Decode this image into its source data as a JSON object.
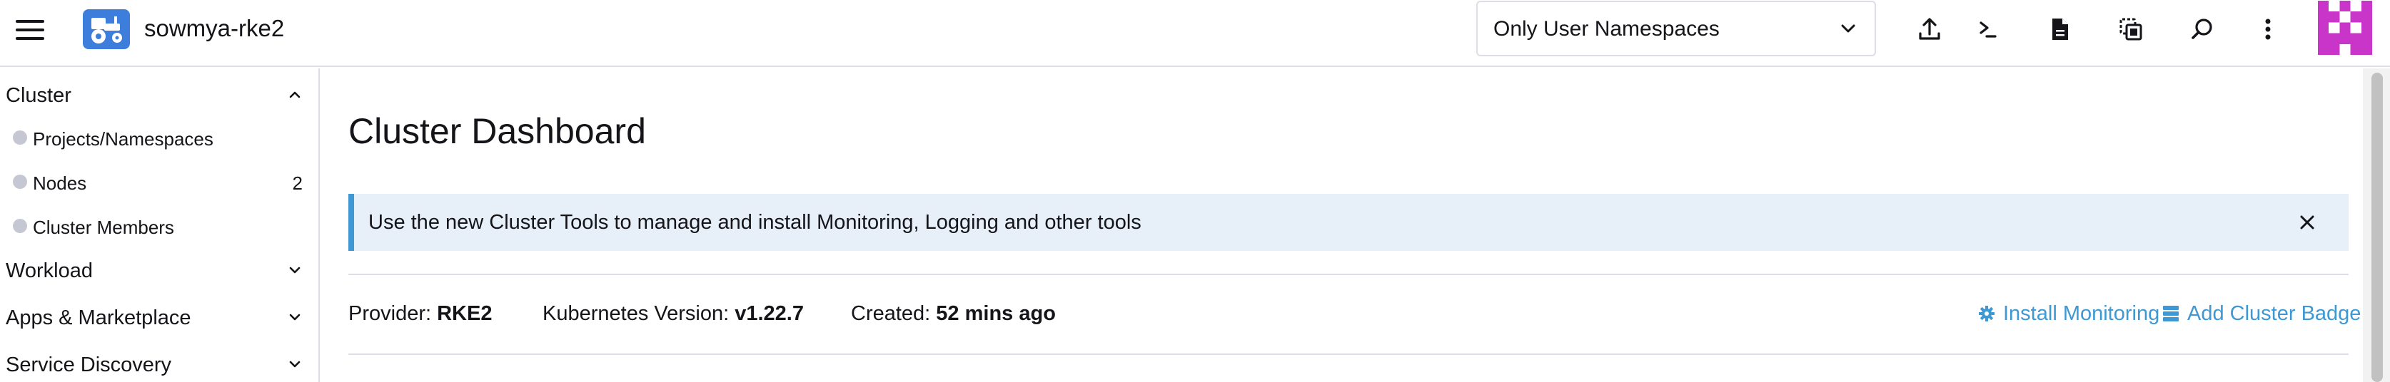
{
  "header": {
    "menu_icon": "hamburger-icon",
    "cluster_icon": "tractor-icon",
    "cluster_name": "sowmya-rke2",
    "namespace_filter": {
      "selected": "Only User Namespaces",
      "icon": "chevron-down-icon"
    },
    "actions": [
      {
        "name": "import-yaml",
        "icon": "upload-icon"
      },
      {
        "name": "kubectl-shell",
        "icon": "terminal-icon"
      },
      {
        "name": "download-kubeconfig",
        "icon": "file-icon"
      },
      {
        "name": "copy-kubeconfig",
        "icon": "copy-icon"
      },
      {
        "name": "search",
        "icon": "search-icon"
      },
      {
        "name": "more",
        "icon": "kebab-menu-icon"
      }
    ],
    "avatar_color": "#c935c9"
  },
  "sidebar": {
    "groups": [
      {
        "label": "Cluster",
        "expanded": true
      },
      {
        "label": "Workload",
        "expanded": false
      },
      {
        "label": "Apps & Marketplace",
        "expanded": false
      },
      {
        "label": "Service Discovery",
        "expanded": false
      }
    ],
    "cluster_items": [
      {
        "label": "Projects/Namespaces",
        "count": ""
      },
      {
        "label": "Nodes",
        "count": "2"
      },
      {
        "label": "Cluster Members",
        "count": ""
      }
    ]
  },
  "main": {
    "title": "Cluster Dashboard",
    "banner": {
      "text": "Use the new Cluster Tools to manage and install Monitoring, Logging and other tools",
      "close_icon": "close-icon"
    },
    "details": {
      "provider_label": "Provider:",
      "provider_value": "RKE2",
      "k8s_label": "Kubernetes Version:",
      "k8s_value": "v1.22.7",
      "created_label": "Created:",
      "created_value": "52 mins ago"
    },
    "actions": {
      "install_monitoring": "Install Monitoring",
      "add_cluster_badge": "Add Cluster Badge"
    }
  },
  "colors": {
    "accent": "#3d98d3",
    "cluster_logo": "#3d7ddc",
    "banner_bg": "#e7eff8",
    "border": "#dcdee7"
  }
}
